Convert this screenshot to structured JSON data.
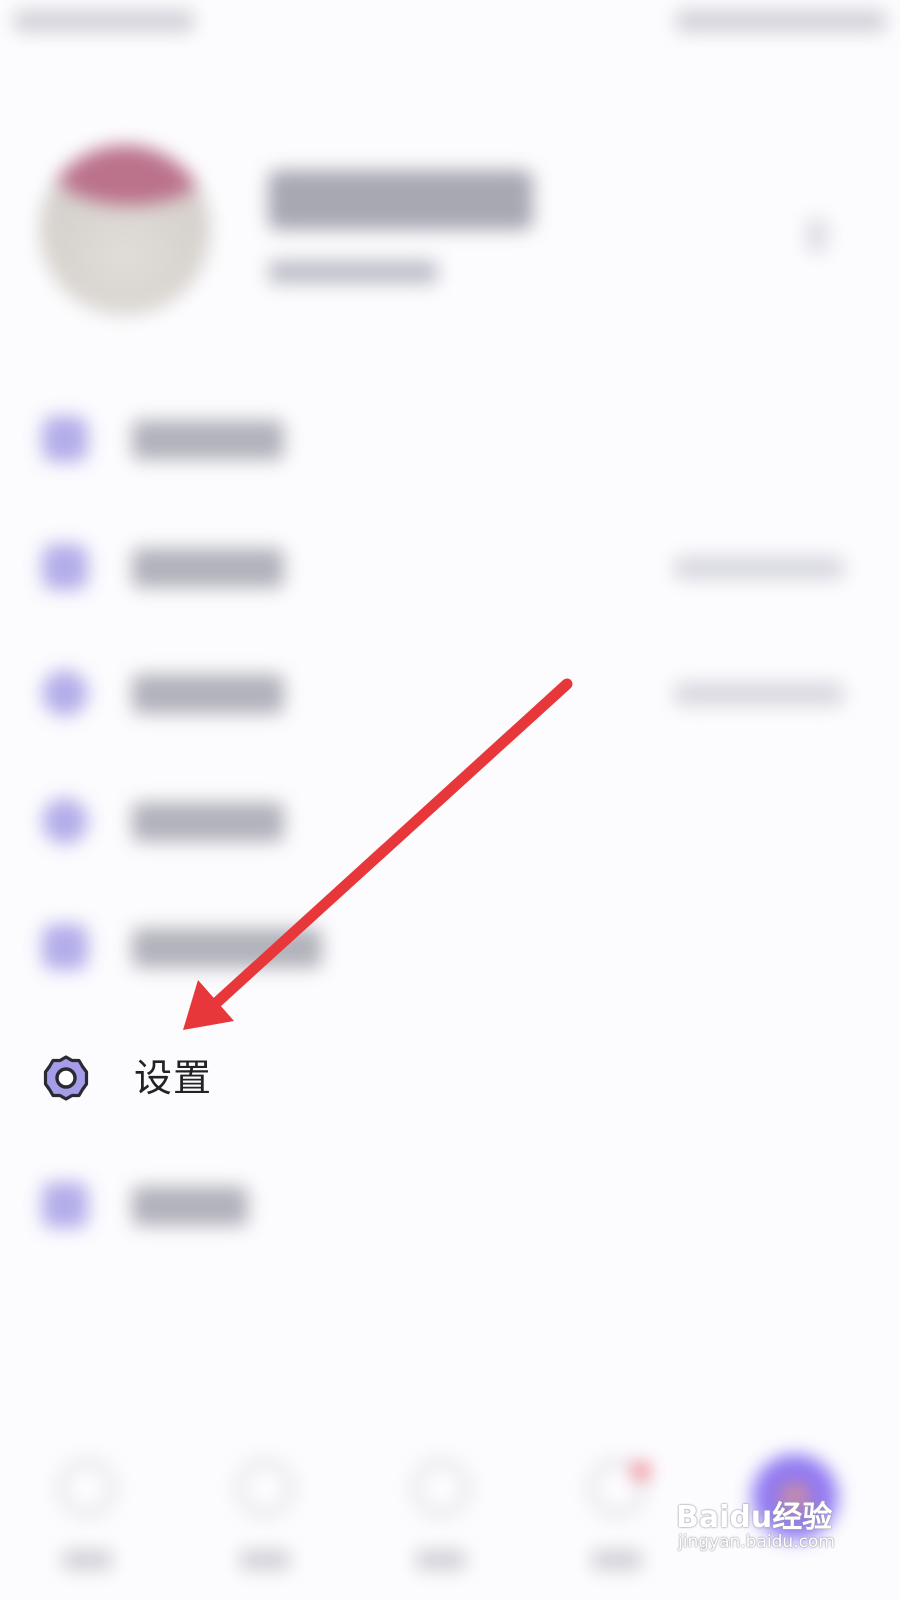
{
  "menu": {
    "settings_label": "设置"
  },
  "watermark": {
    "brand": "Baidu经验",
    "url": "jingyan.baidu.com"
  },
  "colors": {
    "accent": "#7d62f0",
    "icon_purple": "#a69fe6",
    "annotation_arrow": "#e8373a",
    "text": "#222226"
  },
  "icons": {
    "settings": "gear-icon",
    "annotation": "red-arrow-icon"
  }
}
